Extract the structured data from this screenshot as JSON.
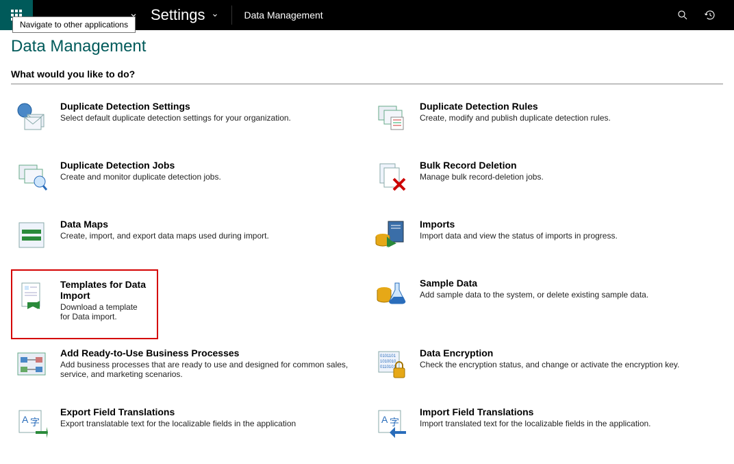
{
  "nav": {
    "tooltip": "Navigate to other applications",
    "settings": "Settings",
    "breadcrumb": "Data Management"
  },
  "page": {
    "title": "Data Management",
    "section": "What would you like to do?"
  },
  "items": {
    "dup_settings": {
      "title": "Duplicate Detection Settings",
      "desc": "Select default duplicate detection settings for your organization."
    },
    "dup_rules": {
      "title": "Duplicate Detection Rules",
      "desc": "Create, modify and publish duplicate detection rules."
    },
    "dup_jobs": {
      "title": "Duplicate Detection Jobs",
      "desc": "Create and monitor duplicate detection jobs."
    },
    "bulk_delete": {
      "title": "Bulk Record Deletion",
      "desc": "Manage bulk record-deletion jobs."
    },
    "data_maps": {
      "title": "Data Maps",
      "desc": "Create, import, and export data maps used during import."
    },
    "imports": {
      "title": "Imports",
      "desc": "Import data and view the status of imports in progress."
    },
    "templates": {
      "title": "Templates for Data Import",
      "desc": "Download a template for Data import."
    },
    "sample_data": {
      "title": "Sample Data",
      "desc": "Add sample data to the system, or delete existing sample data."
    },
    "ready_proc": {
      "title": "Add Ready-to-Use Business Processes",
      "desc": "Add business processes that are ready to use and designed for common sales, service, and marketing scenarios."
    },
    "encryption": {
      "title": "Data Encryption",
      "desc": "Check the encryption status, and change or activate the encryption key."
    },
    "export_trans": {
      "title": "Export Field Translations",
      "desc": "Export translatable text for the localizable fields in the application"
    },
    "import_trans": {
      "title": "Import Field Translations",
      "desc": "Import translated text for the localizable fields in the application."
    }
  }
}
